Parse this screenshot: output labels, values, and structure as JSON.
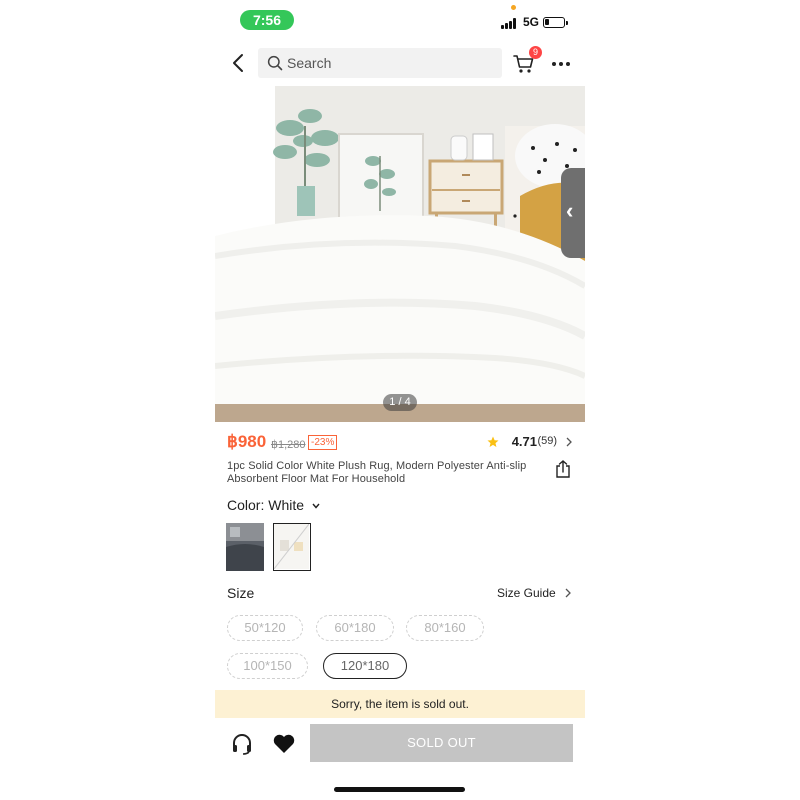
{
  "status_bar": {
    "time": "7:56",
    "network": "5G",
    "battery_level": 0.25
  },
  "header": {
    "search_placeholder": "Search",
    "cart_count": "9",
    "icons": [
      "back-icon",
      "search-icon",
      "cart-icon",
      "more-icon"
    ]
  },
  "gallery": {
    "counter": "1 / 4",
    "side_tab_icon": "‹"
  },
  "product": {
    "price": "฿980",
    "original_price": "฿1,280",
    "discount": "-23%",
    "rating": "4.71",
    "review_count": "(59)",
    "title": "1pc Solid Color White Plush Rug, Modern Polyester Anti-slip Absorbent Floor Mat For Household"
  },
  "color": {
    "label": "Color: White",
    "swatches": [
      "Grey",
      "White"
    ],
    "selected": "White"
  },
  "size": {
    "label": "Size",
    "guide_label": "Size Guide",
    "options": [
      "50*120",
      "60*180",
      "80*160",
      "100*150",
      "120*180"
    ],
    "selected": "120*180"
  },
  "notice": "Sorry, the item is sold out.",
  "bottom_bar": {
    "button_label": "SOLD OUT"
  },
  "colors": {
    "price": "#fa6338",
    "badge": "#fe4545",
    "notice_bg": "#fdf1d3",
    "status_pill": "#34c759",
    "disabled_button": "#c4c4c4"
  }
}
